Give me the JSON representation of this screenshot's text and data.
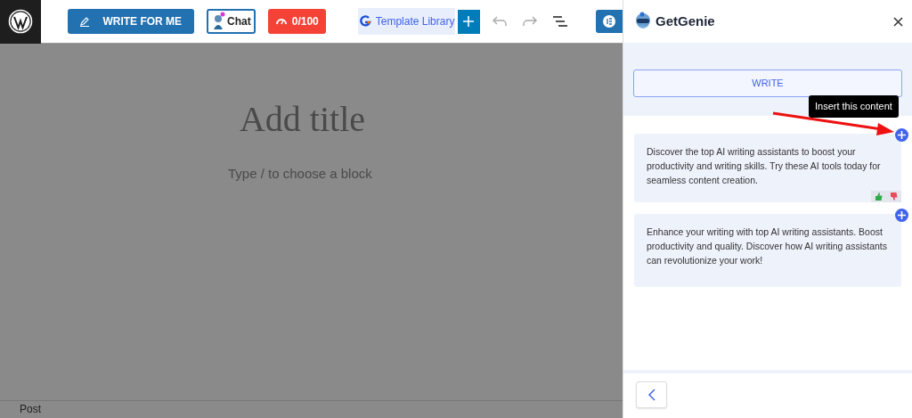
{
  "toolbar": {
    "write_button": "WRITE FOR ME",
    "chat_button": "Chat",
    "score_button": "0/100",
    "template_button": "Template Library"
  },
  "editor": {
    "title_placeholder": "Add title",
    "block_placeholder": "Type / to choose a block"
  },
  "status_bar": {
    "label": "Post"
  },
  "panel": {
    "brand": "GetGenie",
    "write_button": "WRITE",
    "tooltip": "Insert this content",
    "results": [
      {
        "text": "Discover the top AI writing assistants to boost your productivity and writing skills. Try these AI tools today for seamless content creation.",
        "show_feedback": true
      },
      {
        "text": "Enhance your writing with top AI writing assistants. Boost productivity and quality. Discover how AI writing assistants can revolutionize your work!",
        "show_feedback": false
      }
    ]
  }
}
